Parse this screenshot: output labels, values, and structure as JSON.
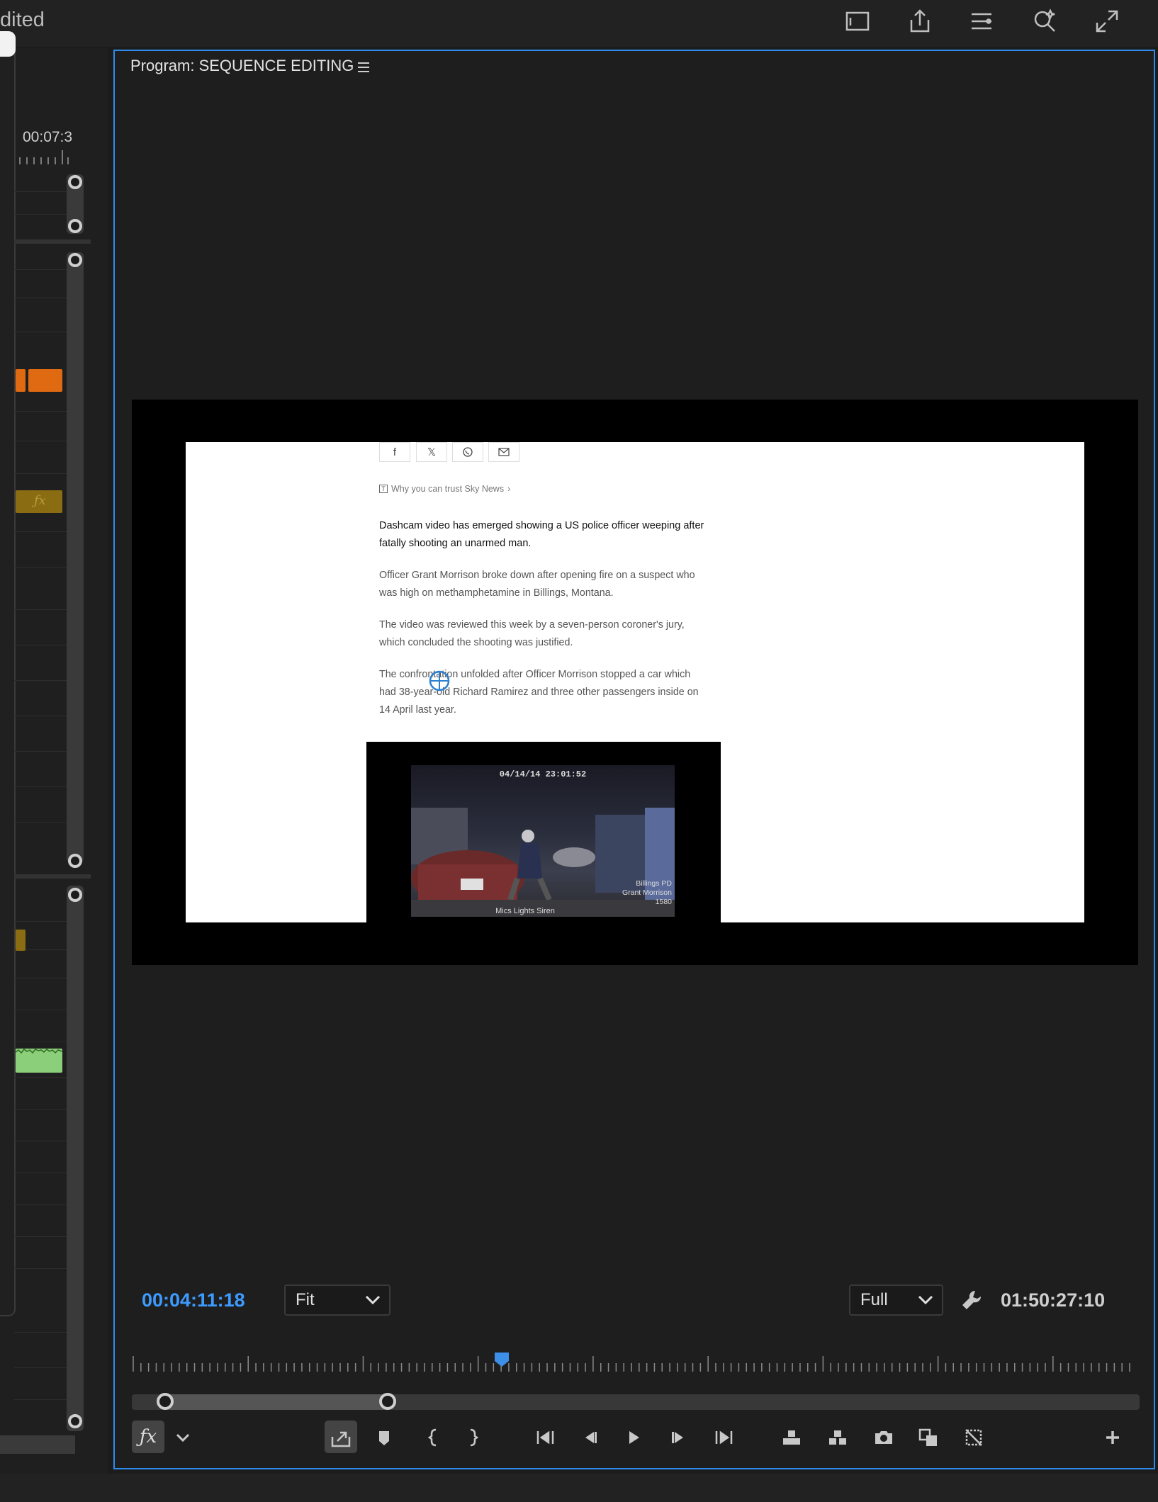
{
  "app": {
    "title_fragment": "dited"
  },
  "left_panel": {
    "timecode": "00:07:3"
  },
  "program_monitor": {
    "title": "Program: SEQUENCE EDITING",
    "playhead_timecode": "00:04:11:18",
    "zoom_level": "Fit",
    "resolution": "Full",
    "duration_timecode": "01:50:27:10",
    "playhead_position_fraction": 0.37,
    "zoom_range_fraction": [
      0.03,
      0.25
    ]
  },
  "article": {
    "share_icons": [
      "facebook-icon",
      "x-icon",
      "whatsapp-icon",
      "email-icon"
    ],
    "trust_link": "Why you can trust Sky News",
    "lead": "Dashcam video has emerged showing a US police officer weeping after fatally shooting an unarmed man.",
    "paragraphs": [
      "Officer Grant Morrison broke down after opening fire on a suspect who was high on methamphetamine in Billings, Montana.",
      "The video was reviewed this week by a seven-person coroner's jury, which concluded the shooting was justified.",
      "The confrontation unfolded after Officer Morrison stopped a car which had 38-year-old Richard Ramirez and three other passengers inside on 14 April last year."
    ],
    "video": {
      "timestamp": "04/14/14 23:01:52",
      "id_text": "Billings PD\nGrant Morrison\n1580",
      "status_text": "Mics  Lights  Siren"
    }
  },
  "colors": {
    "accent": "#2d8ceb",
    "timecode_blue": "#3d9bff",
    "clip_orange": "#e06a12",
    "clip_olive": "#8a6d12",
    "clip_green": "#8ccf7a"
  }
}
